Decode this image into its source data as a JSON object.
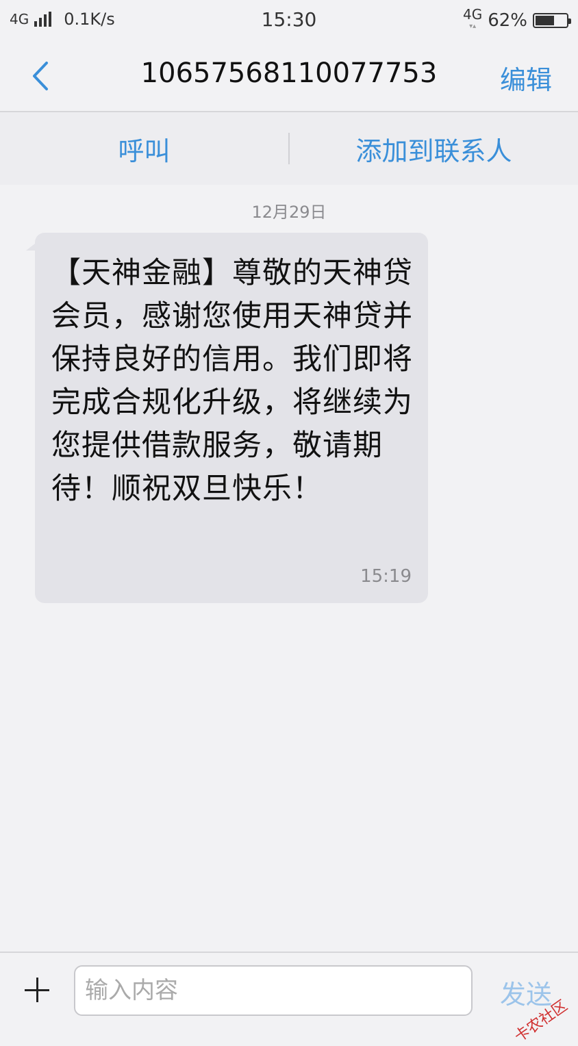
{
  "status_bar": {
    "network_left": "4G",
    "speed": "0.1K/s",
    "time": "15:30",
    "network_right": "4G",
    "battery": "62%",
    "battery_level": 0.62
  },
  "nav": {
    "title": "10657568110077753",
    "edit_label": "编辑"
  },
  "actions": {
    "call_label": "呼叫",
    "add_contact_label": "添加到联系人"
  },
  "conversation": {
    "date": "12月29日",
    "messages": [
      {
        "text": "【天神金融】尊敬的天神贷会员，感谢您使用天神贷并保持良好的信用。我们即将完成合规化升级，将继续为您提供借款服务，敬请期待！顺祝双旦快乐！",
        "time": "15:19"
      }
    ]
  },
  "input_bar": {
    "placeholder": "输入内容",
    "value": "",
    "send_label": "发送"
  },
  "watermark": "卡农社区",
  "colors": {
    "accent": "#3a8fd9",
    "bubble": "#e3e3e8",
    "background": "#f2f2f4"
  }
}
